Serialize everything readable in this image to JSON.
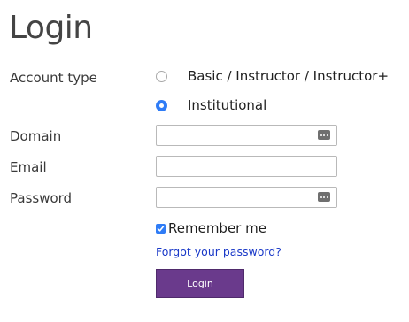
{
  "page": {
    "title": "Login"
  },
  "form": {
    "account_type_label": "Account type",
    "account_type_options": [
      {
        "label": "Basic / Instructor / Instructor+",
        "selected": false
      },
      {
        "label": "Institutional",
        "selected": true
      }
    ],
    "domain_label": "Domain",
    "domain_value": "",
    "email_label": "Email",
    "email_value": "",
    "password_label": "Password",
    "password_value": "",
    "remember_label": "Remember me",
    "remember_checked": true,
    "forgot_link": "Forgot your password?",
    "login_button": "Login"
  },
  "icons": {
    "field_key_icon": "key-icon"
  },
  "colors": {
    "accent_blue": "#2f7cf6",
    "link_blue": "#1a39c8",
    "button_purple": "#6a3a8c"
  }
}
